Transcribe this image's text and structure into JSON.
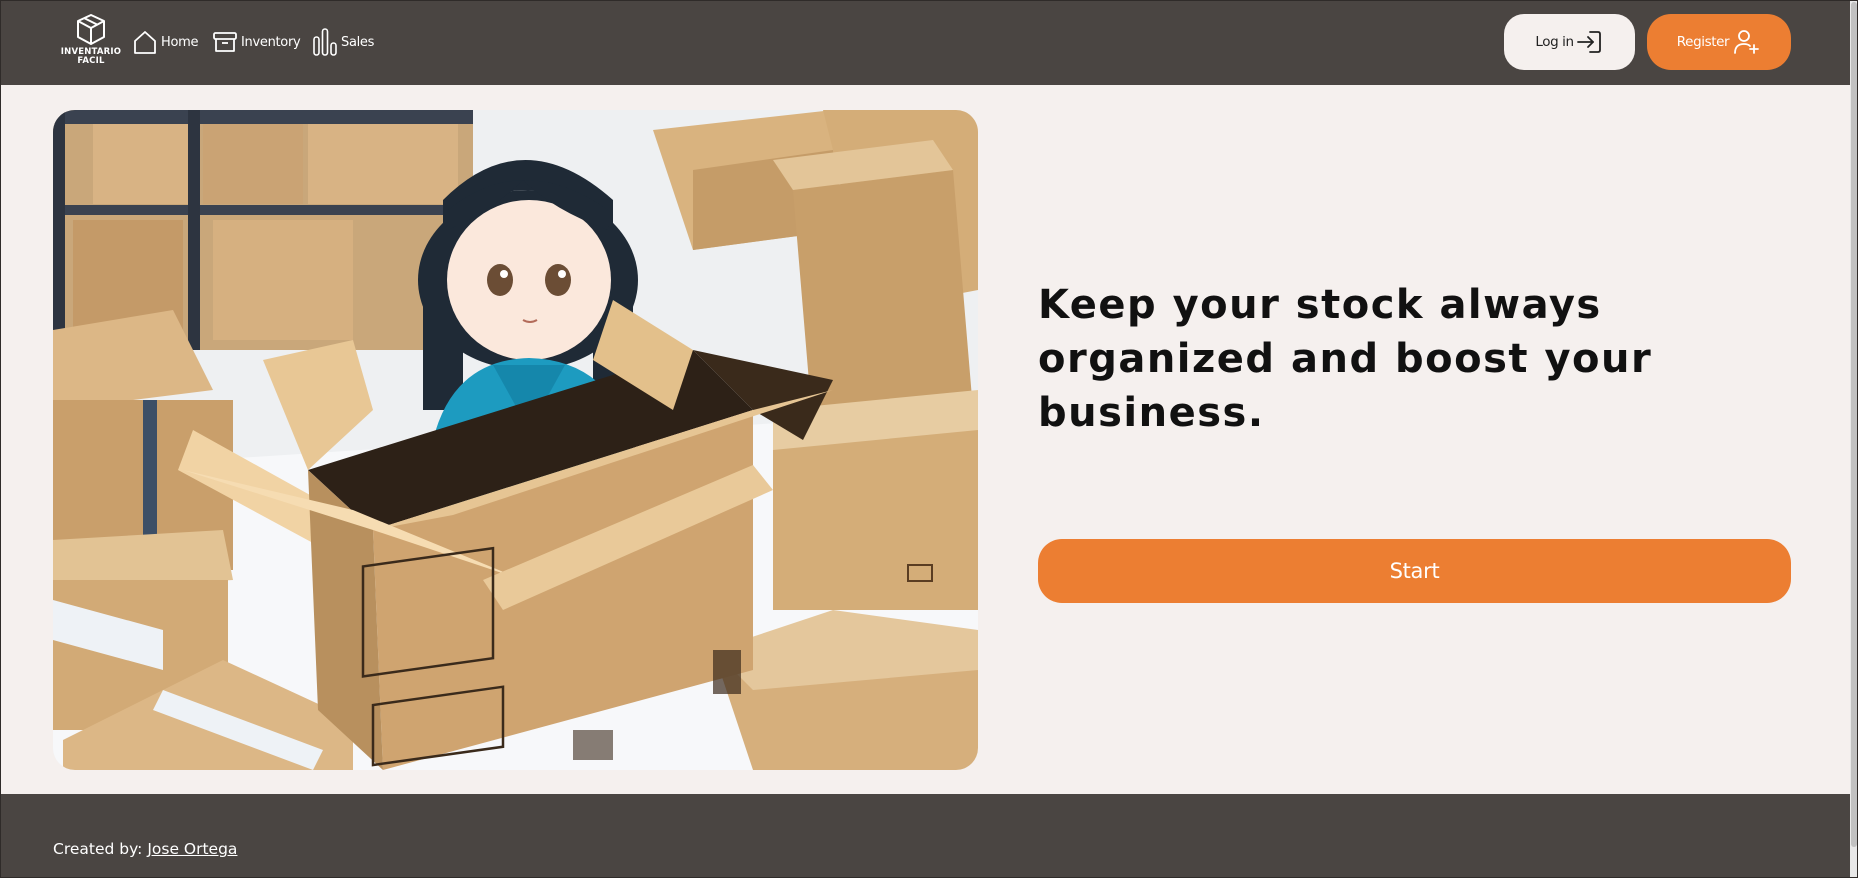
{
  "brand": {
    "logo_line1": "INVENTARIO",
    "logo_line2": "FACIL",
    "icon": "box-logo-icon"
  },
  "nav": [
    {
      "label": "Home",
      "icon": "house-icon"
    },
    {
      "label": "Inventory",
      "icon": "archive-box-icon"
    },
    {
      "label": "Sales",
      "icon": "bar-chart-icon"
    }
  ],
  "auth": {
    "login_label": "Log in",
    "login_icon": "login-arrow-icon",
    "register_label": "Register",
    "register_icon": "user-plus-icon"
  },
  "hero": {
    "headline": "Keep your stock always organized and boost your business.",
    "start_label": "Start"
  },
  "footer": {
    "created_prefix": "Created by:",
    "author": "Jose Ortega"
  },
  "colors": {
    "header_bg": "#4a4542",
    "page_bg": "#f5f0ee",
    "accent": "#ec7e32"
  }
}
